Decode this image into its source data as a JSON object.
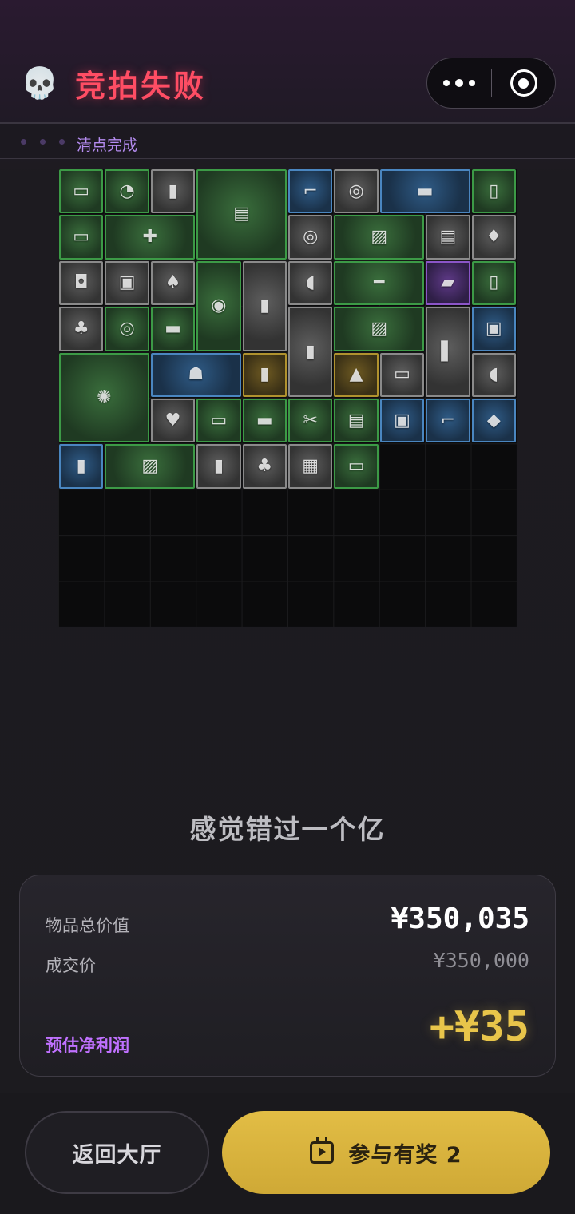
{
  "header": {
    "skull_glyph": "💀",
    "title": "竞拍失败",
    "title_color": "#ff4d64"
  },
  "status": {
    "text": "清点完成"
  },
  "inventory": {
    "grid_cols": 10,
    "grid_rows": 10,
    "items": [
      {
        "name": "power-bank",
        "glyph": "▭",
        "rarity": "green",
        "col": 0,
        "row": 0,
        "w": 1,
        "h": 1
      },
      {
        "name": "dial-gauge",
        "glyph": "◔",
        "rarity": "green",
        "col": 1,
        "row": 0,
        "w": 1,
        "h": 1
      },
      {
        "name": "protein-can",
        "glyph": "▮",
        "rarity": "gray",
        "col": 2,
        "row": 0,
        "w": 1,
        "h": 1
      },
      {
        "name": "newspaper",
        "glyph": "▤",
        "rarity": "green",
        "col": 3,
        "row": 0,
        "w": 2,
        "h": 2
      },
      {
        "name": "thermometer-gun",
        "glyph": "⌐",
        "rarity": "blue",
        "col": 5,
        "row": 0,
        "w": 1,
        "h": 1
      },
      {
        "name": "tape-roll",
        "glyph": "◎",
        "rarity": "gray",
        "col": 6,
        "row": 0,
        "w": 1,
        "h": 1
      },
      {
        "name": "rifle",
        "glyph": "▬",
        "rarity": "blue",
        "col": 7,
        "row": 0,
        "w": 2,
        "h": 1
      },
      {
        "name": "lighter",
        "glyph": "▯",
        "rarity": "green",
        "col": 9,
        "row": 0,
        "w": 1,
        "h": 1
      },
      {
        "name": "power-strip",
        "glyph": "▭",
        "rarity": "green",
        "col": 0,
        "row": 1,
        "w": 1,
        "h": 1
      },
      {
        "name": "power-drill",
        "glyph": "✚",
        "rarity": "green",
        "col": 1,
        "row": 1,
        "w": 2,
        "h": 1
      },
      {
        "name": "tape-roll",
        "glyph": "◎",
        "rarity": "gray",
        "col": 5,
        "row": 1,
        "w": 1,
        "h": 1
      },
      {
        "name": "old-map",
        "glyph": "▨",
        "rarity": "green",
        "col": 6,
        "row": 1,
        "w": 2,
        "h": 1
      },
      {
        "name": "documents",
        "glyph": "▤",
        "rarity": "gray",
        "col": 8,
        "row": 1,
        "w": 1,
        "h": 1
      },
      {
        "name": "playing-card",
        "glyph": "♦",
        "rarity": "gray",
        "col": 9,
        "row": 1,
        "w": 1,
        "h": 1
      },
      {
        "name": "yogurt-cup",
        "glyph": "◘",
        "rarity": "gray",
        "col": 0,
        "row": 2,
        "w": 1,
        "h": 1
      },
      {
        "name": "snack-bag",
        "glyph": "▣",
        "rarity": "gray",
        "col": 1,
        "row": 2,
        "w": 1,
        "h": 1
      },
      {
        "name": "playing-card",
        "glyph": "♠",
        "rarity": "gray",
        "col": 2,
        "row": 2,
        "w": 1,
        "h": 1
      },
      {
        "name": "pressure-gauge",
        "glyph": "◉",
        "rarity": "green",
        "col": 3,
        "row": 2,
        "w": 1,
        "h": 2
      },
      {
        "name": "medicine-bottle",
        "glyph": "▮",
        "rarity": "gray",
        "col": 4,
        "row": 2,
        "w": 1,
        "h": 2
      },
      {
        "name": "computer-mouse",
        "glyph": "◖",
        "rarity": "gray",
        "col": 5,
        "row": 2,
        "w": 1,
        "h": 1
      },
      {
        "name": "glass-tube",
        "glyph": "━",
        "rarity": "green",
        "col": 6,
        "row": 2,
        "w": 2,
        "h": 1
      },
      {
        "name": "ram-stick",
        "glyph": "▰",
        "rarity": "purple",
        "col": 8,
        "row": 2,
        "w": 1,
        "h": 1
      },
      {
        "name": "water-bottle",
        "glyph": "▯",
        "rarity": "green",
        "col": 9,
        "row": 2,
        "w": 1,
        "h": 1
      },
      {
        "name": "playing-card",
        "glyph": "♣",
        "rarity": "gray",
        "col": 0,
        "row": 3,
        "w": 1,
        "h": 1
      },
      {
        "name": "wire-coil",
        "glyph": "◎",
        "rarity": "green",
        "col": 1,
        "row": 3,
        "w": 1,
        "h": 1
      },
      {
        "name": "candy-bar",
        "glyph": "▬",
        "rarity": "green",
        "col": 2,
        "row": 3,
        "w": 1,
        "h": 1
      },
      {
        "name": "toothpaste",
        "glyph": "▮",
        "rarity": "gray",
        "col": 5,
        "row": 3,
        "w": 1,
        "h": 2
      },
      {
        "name": "old-map",
        "glyph": "▨",
        "rarity": "green",
        "col": 6,
        "row": 3,
        "w": 2,
        "h": 1
      },
      {
        "name": "metal-bracket",
        "glyph": "▌",
        "rarity": "gray",
        "col": 8,
        "row": 3,
        "w": 1,
        "h": 2
      },
      {
        "name": "travel-adapter",
        "glyph": "▣",
        "rarity": "blue",
        "col": 9,
        "row": 3,
        "w": 1,
        "h": 1
      },
      {
        "name": "ornate-plate",
        "glyph": "✺",
        "rarity": "green",
        "col": 0,
        "row": 4,
        "w": 2,
        "h": 2
      },
      {
        "name": "tobacco-pipe",
        "glyph": "☗",
        "rarity": "blue",
        "col": 2,
        "row": 4,
        "w": 2,
        "h": 1
      },
      {
        "name": "coffee-bottle",
        "glyph": "▮",
        "rarity": "gold",
        "col": 4,
        "row": 4,
        "w": 1,
        "h": 1
      },
      {
        "name": "cheese-wedge",
        "glyph": "▲",
        "rarity": "gold",
        "col": 6,
        "row": 4,
        "w": 1,
        "h": 1
      },
      {
        "name": "matchbox",
        "glyph": "▭",
        "rarity": "gray",
        "col": 7,
        "row": 4,
        "w": 1,
        "h": 1
      },
      {
        "name": "computer-mouse",
        "glyph": "◖",
        "rarity": "gray",
        "col": 9,
        "row": 4,
        "w": 1,
        "h": 1
      },
      {
        "name": "playing-card",
        "glyph": "♥",
        "rarity": "gray",
        "col": 2,
        "row": 5,
        "w": 1,
        "h": 1
      },
      {
        "name": "power-bank",
        "glyph": "▭",
        "rarity": "green",
        "col": 3,
        "row": 5,
        "w": 1,
        "h": 1
      },
      {
        "name": "good-luck-card",
        "glyph": "▬",
        "rarity": "green",
        "col": 4,
        "row": 5,
        "w": 1,
        "h": 1
      },
      {
        "name": "pliers",
        "glyph": "✂",
        "rarity": "green",
        "col": 5,
        "row": 5,
        "w": 1,
        "h": 1
      },
      {
        "name": "tool-tray",
        "glyph": "▤",
        "rarity": "green",
        "col": 6,
        "row": 5,
        "w": 1,
        "h": 1
      },
      {
        "name": "ammo-tin",
        "glyph": "▣",
        "rarity": "blue",
        "col": 7,
        "row": 5,
        "w": 1,
        "h": 1
      },
      {
        "name": "thermometer-gun",
        "glyph": "⌐",
        "rarity": "blue",
        "col": 8,
        "row": 5,
        "w": 1,
        "h": 1
      },
      {
        "name": "cpu-chip",
        "glyph": "◆",
        "rarity": "blue",
        "col": 9,
        "row": 5,
        "w": 1,
        "h": 1
      },
      {
        "name": "soda-can",
        "glyph": "▮",
        "rarity": "blue",
        "col": 0,
        "row": 6,
        "w": 1,
        "h": 1
      },
      {
        "name": "old-map",
        "glyph": "▨",
        "rarity": "green",
        "col": 1,
        "row": 6,
        "w": 2,
        "h": 1
      },
      {
        "name": "protein-can",
        "glyph": "▮",
        "rarity": "gray",
        "col": 3,
        "row": 6,
        "w": 1,
        "h": 1
      },
      {
        "name": "playing-card",
        "glyph": "♣",
        "rarity": "gray",
        "col": 4,
        "row": 6,
        "w": 1,
        "h": 1
      },
      {
        "name": "pill-organizer",
        "glyph": "▦",
        "rarity": "gray",
        "col": 5,
        "row": 6,
        "w": 1,
        "h": 1
      },
      {
        "name": "power-bank",
        "glyph": "▭",
        "rarity": "green",
        "col": 6,
        "row": 6,
        "w": 1,
        "h": 1
      }
    ]
  },
  "result": {
    "tagline": "感觉错过一个亿",
    "total_value_label": "物品总价值",
    "total_value": "¥350,035",
    "deal_price_label": "成交价",
    "deal_price": "¥350,000",
    "profit_label": "预估净利润",
    "profit": "+¥35",
    "profit_color": "#e8c54a"
  },
  "footer": {
    "back_label": "返回大厅",
    "join_label": "参与有奖 2",
    "join_icon": "calendar-play-icon",
    "join_color": "#ddb840"
  }
}
